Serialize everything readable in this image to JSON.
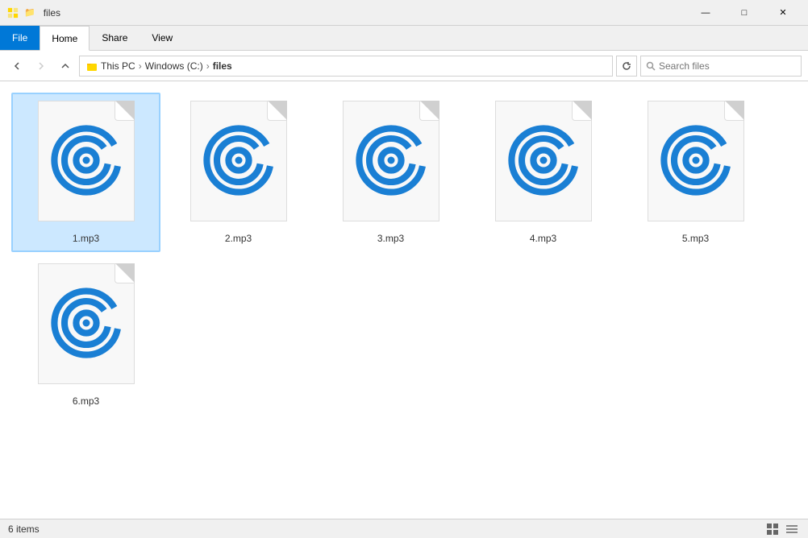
{
  "titleBar": {
    "title": "files",
    "minimize": "—",
    "maximize": "□",
    "close": "✕"
  },
  "ribbon": {
    "tabs": [
      {
        "label": "File",
        "id": "file",
        "active": false,
        "isFile": true
      },
      {
        "label": "Home",
        "id": "home",
        "active": true,
        "isFile": false
      },
      {
        "label": "Share",
        "id": "share",
        "active": false,
        "isFile": false
      },
      {
        "label": "View",
        "id": "view",
        "active": false,
        "isFile": false
      }
    ]
  },
  "addressBar": {
    "backDisabled": false,
    "forwardDisabled": true,
    "upDisabled": false,
    "paths": [
      "This PC",
      "Windows (C:)",
      "files"
    ],
    "searchPlaceholder": "Search files",
    "searchValue": "Search"
  },
  "files": [
    {
      "name": "1.mp3",
      "selected": true
    },
    {
      "name": "2.mp3",
      "selected": false
    },
    {
      "name": "3.mp3",
      "selected": false
    },
    {
      "name": "4.mp3",
      "selected": false
    },
    {
      "name": "5.mp3",
      "selected": false
    },
    {
      "name": "6.mp3",
      "selected": false
    }
  ],
  "statusBar": {
    "itemCount": "6 items",
    "selectedInfo": ""
  },
  "colors": {
    "accent": "#0078d7",
    "mp3Icon": "#1a7fd4"
  }
}
